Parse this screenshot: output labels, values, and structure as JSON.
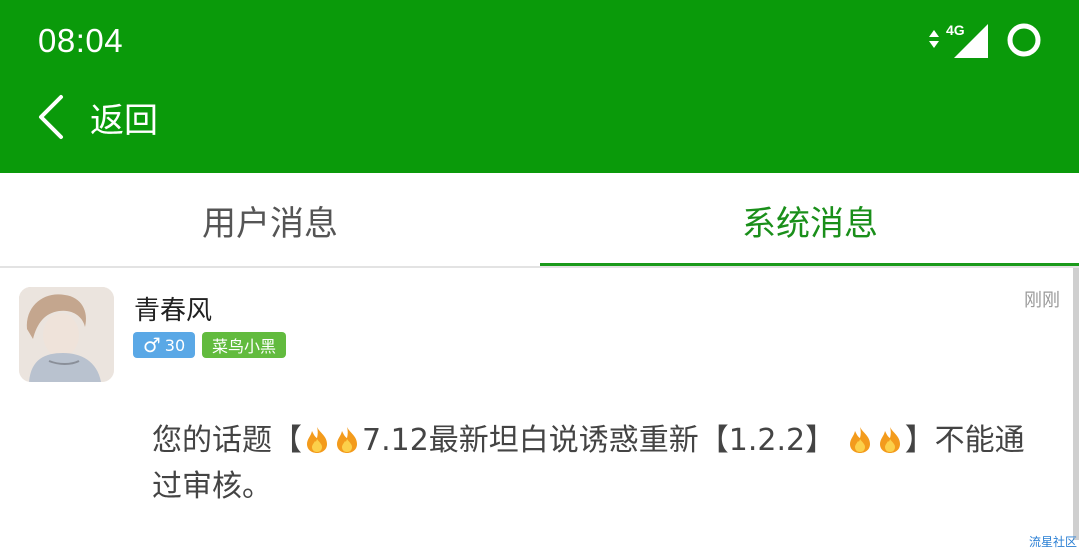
{
  "status_bar": {
    "time": "08:04",
    "network": "4G",
    "icons": [
      "network-arrows-icon",
      "signal-icon",
      "battery-ring-icon"
    ]
  },
  "nav": {
    "back_label": "返回",
    "back_icon": "chevron-left-icon"
  },
  "tabs": [
    {
      "label": "用户消息",
      "active": false
    },
    {
      "label": "系统消息",
      "active": true
    }
  ],
  "message": {
    "username": "青春风",
    "gender_icon": "male-icon",
    "gender_symbol": "♂",
    "age": "30",
    "level": "菜鸟小黑",
    "time": "刚刚",
    "text_before": "您的话题【",
    "text_middle": "7.12最新坦白说诱惑重新【1.2.2】",
    "text_after": "】不能通过审核。",
    "fire_icon": "fire-icon"
  },
  "watermark": "流星社区",
  "colors": {
    "header_bg": "#0a9a0a",
    "active_tab": "#1a8f1a",
    "gender_badge": "#5aa8e6",
    "level_badge": "#62bb3e"
  }
}
